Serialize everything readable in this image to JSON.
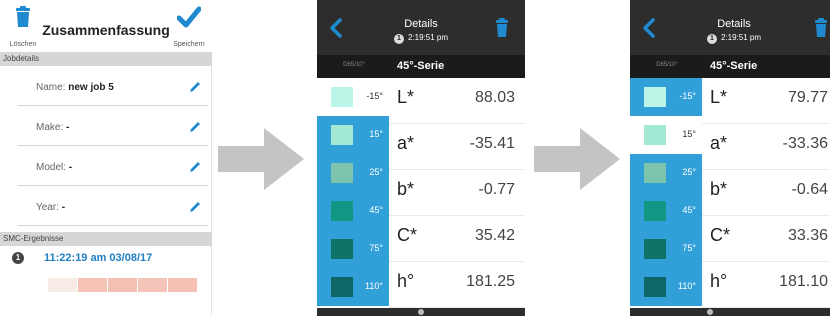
{
  "screen1": {
    "title": "Zusammenfassung",
    "delete_label": "Löschen",
    "save_label": "Speichern",
    "jobdetails_label": "Jobdetails",
    "fields": [
      {
        "label": "Name: ",
        "value": "new job 5"
      },
      {
        "label": "Make: ",
        "value": "-"
      },
      {
        "label": "Model: ",
        "value": "-"
      },
      {
        "label": "Year: ",
        "value": "-"
      }
    ],
    "smc_label": "SMC-Ergebnisse",
    "result": {
      "number": "1",
      "timestamp": "11:22:19 am 03/08/17"
    },
    "swatch_colors": [
      "#f7ebe6",
      "#f4c3b6",
      "#f4c0b3",
      "#f5c4b8",
      "#f4c1b4"
    ],
    "accent": "#1f7fc2"
  },
  "details_a": {
    "title": "Details",
    "badge": "1",
    "time": "2:19:51 pm",
    "illuminant": "D65/10°",
    "series": "45°-Serie",
    "angles": [
      {
        "label": "-15°",
        "color": "#bdf4e8",
        "selected": false
      },
      {
        "label": "15°",
        "color": "#a3e8d5",
        "selected": true
      },
      {
        "label": "25°",
        "color": "#7dc4ad",
        "selected": true
      },
      {
        "label": "45°",
        "color": "#129784",
        "selected": true
      },
      {
        "label": "75°",
        "color": "#0f7268",
        "selected": true
      },
      {
        "label": "110°",
        "color": "#0e6766",
        "selected": true
      }
    ],
    "values": [
      {
        "name": "L*",
        "value": "88.03"
      },
      {
        "name": "a*",
        "value": "-35.41"
      },
      {
        "name": "b*",
        "value": "-0.77"
      },
      {
        "name": "C*",
        "value": "35.42"
      },
      {
        "name": "h°",
        "value": "181.25"
      }
    ]
  },
  "details_b": {
    "title": "Details",
    "badge": "1",
    "time": "2:19:51 pm",
    "illuminant": "D65/10°",
    "series": "45°-Serie",
    "angles": [
      {
        "label": "-15°",
        "color": "#bdf4e8",
        "selected": true
      },
      {
        "label": "15°",
        "color": "#a3e8d5",
        "selected": false
      },
      {
        "label": "25°",
        "color": "#7dc4ad",
        "selected": true
      },
      {
        "label": "45°",
        "color": "#129784",
        "selected": true
      },
      {
        "label": "75°",
        "color": "#0f7268",
        "selected": true
      },
      {
        "label": "110°",
        "color": "#0e6766",
        "selected": true
      }
    ],
    "values": [
      {
        "name": "L*",
        "value": "79.77"
      },
      {
        "name": "a*",
        "value": "-33.36"
      },
      {
        "name": "b*",
        "value": "-0.64"
      },
      {
        "name": "C*",
        "value": "33.36"
      },
      {
        "name": "h°",
        "value": "181.10"
      }
    ]
  },
  "colors": {
    "selected_blue": "#31a0d9",
    "header_dark": "#2d2d2d",
    "icon_blue": "#1f8ad0"
  }
}
